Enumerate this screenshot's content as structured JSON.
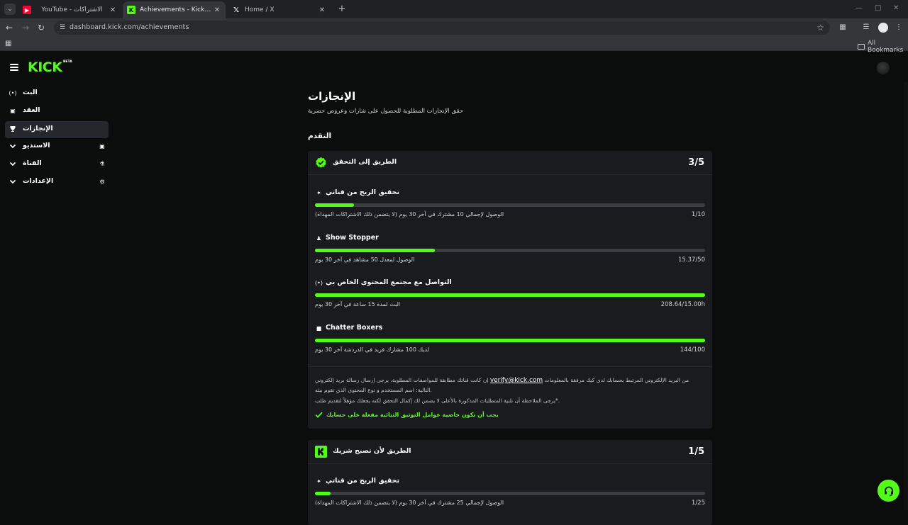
{
  "browser": {
    "tabs": [
      {
        "title": "YouTube - الاشتراكات",
        "favicon": "youtube-icon"
      },
      {
        "title": "Achievements - Kick Dashboard",
        "favicon": "kick-icon"
      },
      {
        "title": "Home / X",
        "favicon": "x-icon"
      }
    ],
    "url": "dashboard.kick.com/achievements",
    "bookmarks_folder": "All Bookmarks"
  },
  "header": {
    "logo": "KICK",
    "beta": "BETA"
  },
  "sidebar": {
    "items": [
      {
        "label": "البث",
        "icon": "broadcast-icon"
      },
      {
        "label": "العقد",
        "icon": "contract-icon"
      },
      {
        "label": "الإنجازات",
        "icon": "trophy-icon"
      },
      {
        "label": "الاستديو",
        "icon": "studio-icon"
      },
      {
        "label": "القناة",
        "icon": "channel-icon"
      },
      {
        "label": "الإعدادات",
        "icon": "settings-icon"
      }
    ]
  },
  "main": {
    "title": "الإنجازات",
    "subtitle": "حقق الإنجازات المطلوبة للحصول على شارات وعروض حصرية",
    "section": "التقدم",
    "cards": [
      {
        "title": "الطريق إلى التحقق",
        "count": "3/5",
        "criteria": [
          {
            "title": "تحقيق الربح من قناتي",
            "desc": "الوصول لإجمالي 10 مشترك في آخر 30 يوم (لا يتضمن ذلك الاشتراكات المهداة)",
            "value": "1/10",
            "progress": 0.1,
            "icon": "sparkle-icon"
          },
          {
            "title": "Show Stopper",
            "desc": "الوصول لمعدل 50 مشاهد في آخر 30 يوم",
            "value": "15.37/50",
            "progress": 0.307,
            "icon": "viewers-icon"
          },
          {
            "title": "التواصل مع مجتمع المحتوى الخاص بي",
            "desc": "البث لمدة 15 ساعة في آخر 30 يوم",
            "value": "208.64/15.00h",
            "progress": 1.0,
            "icon": "broadcast-icon"
          },
          {
            "title": "Chatter Boxers",
            "desc": "لديك 100 مشارك فريد في الدردشة آخر 30 يوم",
            "value": "144/100",
            "progress": 1.0,
            "icon": "chat-icon"
          }
        ],
        "info": {
          "line1_pre": "إن كانت قناتك مطابقة للمواصفات المطلوبة، يرجى إرسال رسالة بريد إلكتروني",
          "email": "verify@kick.com",
          "line1_post": "من البريد الإلكتروني المرتبط بحسابك لدى كيك مرفقة بالمعلومات التالية: اسم المستخدم و نوع المحتوى الذي تقوم ببثه.",
          "line2": "يرجى الملاحظة أن تلبية المتطلبات المذكورة بالأعلى لا يضمن لك إكمال التحقق لكنه يجعلك مؤهلاً لتقديم طلب*.",
          "line3": "يجب أن تكون خاصية عوامل التوثيق الثنائية مفعلة على حسابك"
        }
      },
      {
        "title": "الطريق لأن تصبح شريك",
        "count": "1/5",
        "criteria": [
          {
            "title": "تحقيق الربح من قناتي",
            "desc": "الوصول لإجمالي 25 مشترك في آخر 30 يوم (لا يتضمن ذلك الاشتراكات المهداة)",
            "value": "1/25",
            "progress": 0.04,
            "icon": "sparkle-icon"
          }
        ]
      }
    ]
  },
  "colors": {
    "accent": "#53fc18",
    "card": "#191b1f",
    "background": "#0b0d0c",
    "track": "#3a3d42"
  }
}
